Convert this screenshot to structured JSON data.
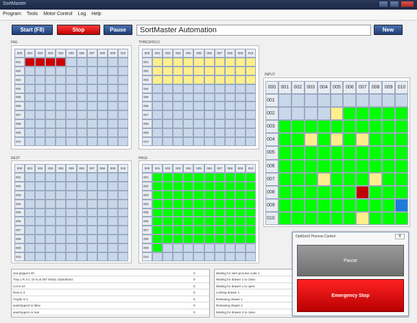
{
  "window": {
    "title": "SortMaster"
  },
  "menu": [
    "Program",
    "Tools",
    "Motor Control",
    "Log",
    "Help"
  ],
  "toolbar": {
    "start": "Start (F8)",
    "stop": "Stop",
    "pause": "Pause",
    "app_title": "SortMaster Automation",
    "new": "New"
  },
  "grid_headers": [
    "000",
    "001",
    "002",
    "003",
    "004",
    "005",
    "006",
    "007",
    "008",
    "009",
    "010"
  ],
  "row_labels": [
    "001",
    "002",
    "003",
    "004",
    "005",
    "006",
    "007",
    "008",
    "009",
    "010"
  ],
  "input_rows": [
    "001",
    "002",
    "003",
    "004",
    "005",
    "006",
    "007",
    "008",
    "009",
    "010"
  ],
  "panels": {
    "fail": {
      "label": "FAIL"
    },
    "threshold": {
      "label": "THRESHOLD"
    },
    "input": {
      "label": "INPUT"
    },
    "rest": {
      "label": "REST"
    },
    "pass": {
      "label": "PASS"
    }
  },
  "grids": {
    "fail": {
      "highlighted": {
        "001": [
          "000",
          "001",
          "002",
          "003"
        ]
      },
      "color": "#cc0000"
    },
    "threshold": {
      "rows": {
        "001": "all",
        "002": "all",
        "003": "all"
      },
      "color": "#ffef8c"
    },
    "pass": {
      "rows": {
        "001": "all",
        "002": "all",
        "003": "all",
        "004": "all",
        "005": "all",
        "006": "all",
        "007": "all",
        "008": "all"
      }
    }
  },
  "log_left": [
    {
      "text": "sea gripper1 lift",
      "value": "0"
    },
    {
      "text": "Tray 1 R 3 C 10 is at 267 91911 315448444",
      "value": "0"
    },
    {
      "text": "Col is 10",
      "value": "0"
    },
    {
      "text": "Row is 3",
      "value": "0"
    },
    {
      "text": "TrayID is 3",
      "value": "0"
    },
    {
      "text": "seaGripper2 is false",
      "value": "0"
    },
    {
      "text": "seaGripper1 is true",
      "value": "0"
    }
  ],
  "log_right": [
    {
      "text": "Waiting for inter-process code 1"
    },
    {
      "text": "Waiting for drawer 1 to close."
    },
    {
      "text": "Waiting for drawer 1 to open."
    },
    {
      "text": "Locking drawer 1"
    },
    {
      "text": "Releasing drawer 1"
    },
    {
      "text": "Releasing drawer 2"
    },
    {
      "text": "Waiting for drawer 2 to close."
    }
  ],
  "dialog": {
    "title": "OptiSort2 Process Control",
    "close": "X",
    "pause": "Pause",
    "stop": "Emergency Stop"
  }
}
